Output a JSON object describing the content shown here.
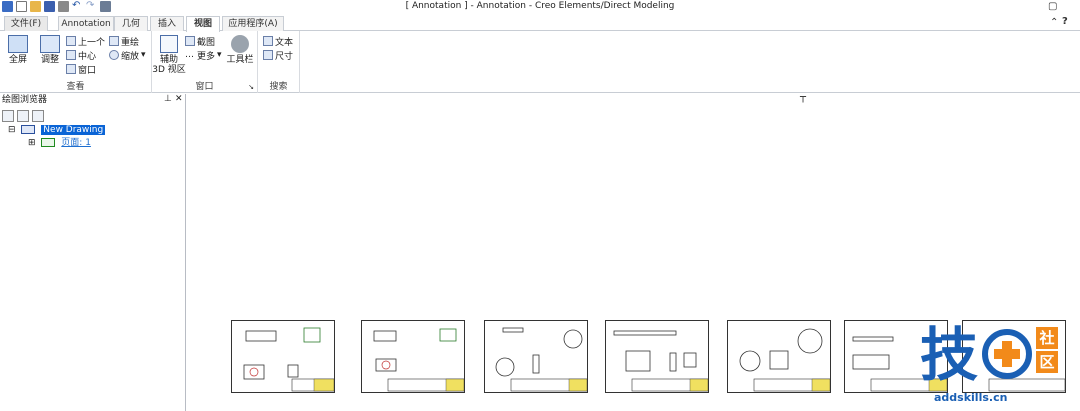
{
  "window": {
    "title": "[ Annotation ] - Annotation - Creo Elements/Direct Modeling"
  },
  "tabs": [
    {
      "label": "文件(F)"
    },
    {
      "label": "Annotation"
    },
    {
      "label": "几何"
    },
    {
      "label": "插入"
    },
    {
      "label": "视图"
    },
    {
      "label": "应用程序(A)"
    }
  ],
  "ribbon": {
    "view_group": {
      "label": "查看",
      "fullscreen": "全屏",
      "adjust": "调整",
      "previous": "上一个",
      "center": "中心",
      "window": "窗口",
      "redraw": "重绘",
      "zoom": "缩放"
    },
    "window_group": {
      "label": "窗口",
      "aux_line1": "辅助",
      "aux_line2": "3D 视区",
      "screenshot": "截图",
      "more": "更多",
      "toolbar": "工具栏"
    },
    "search_group": {
      "label": "搜索",
      "text": "文本",
      "dimension": "尺寸"
    }
  },
  "browser": {
    "title": "绘图浏览器",
    "root": "New Drawing",
    "child": "页面: 1"
  },
  "sheets_count_label": "",
  "watermark": {
    "char": "技",
    "badge1": "社",
    "badge2": "区",
    "site": "addskills.cn"
  },
  "colors": {
    "selection": "#0a64d6",
    "accent_orange": "#f28a1a",
    "logo_blue": "#1a5fb4"
  }
}
